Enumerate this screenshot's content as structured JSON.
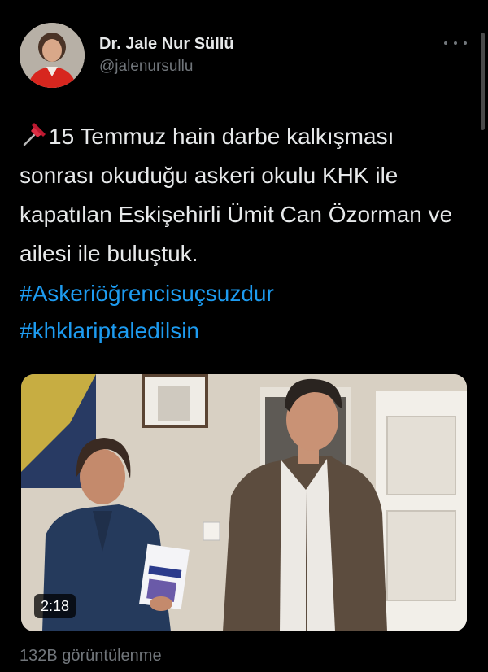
{
  "author": {
    "display_name": "Dr. Jale Nur Süllü",
    "handle": "@jalenursullu",
    "avatar_icon": "profile-photo"
  },
  "tweet": {
    "text": "15 Temmuz hain darbe kalkışması sonrası okuduğu askeri okulu KHK ile kapatılan Eskişehirli Ümit Can Özorman ve ailesi ile buluştuk.",
    "leading_icon": "pushpin-icon",
    "hashtags": [
      "#Askeriöğrencisuçsuzdur",
      "#khklariptaledilsin"
    ]
  },
  "media": {
    "type": "video",
    "duration": "2:18"
  },
  "footer": {
    "views": "132B görüntülenme"
  },
  "colors": {
    "background": "#000000",
    "text": "#e7e9ea",
    "secondary": "#71767b",
    "link": "#1d9bf0"
  }
}
